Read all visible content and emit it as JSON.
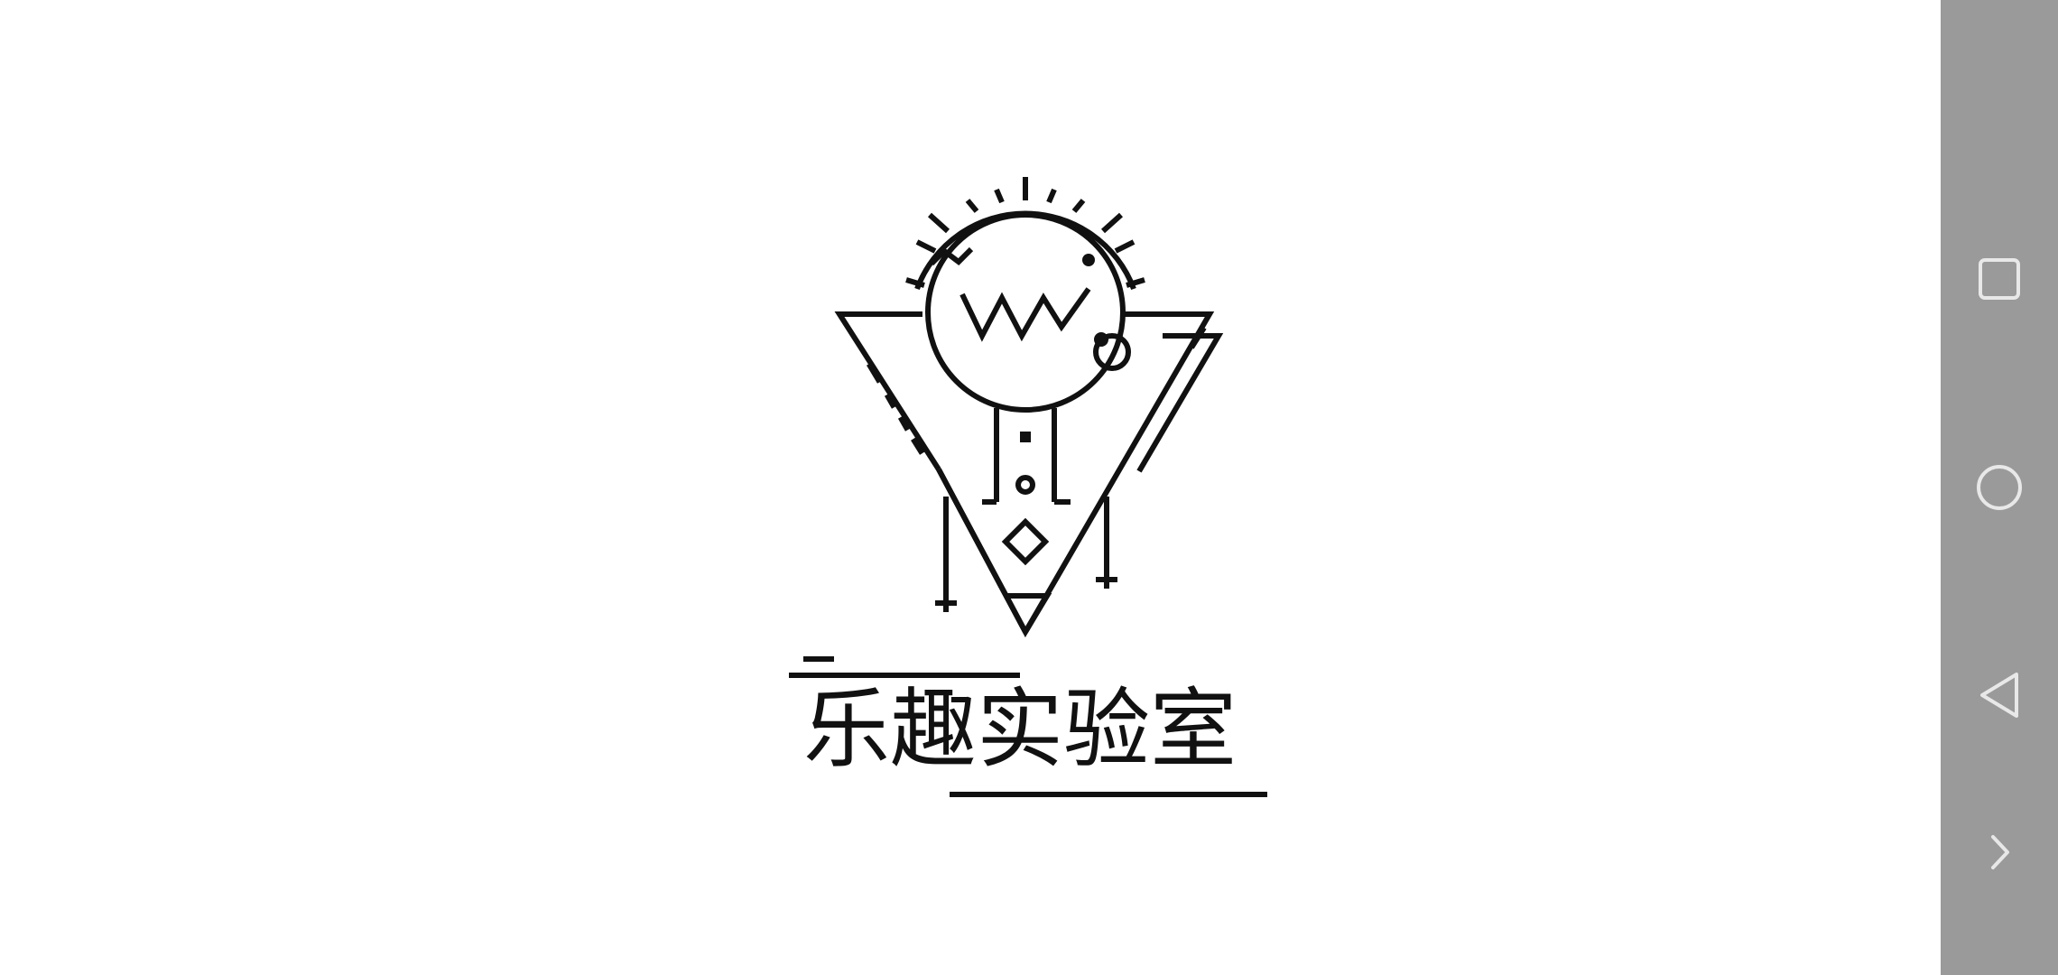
{
  "splash": {
    "brand_title": "乐趣实验室",
    "logo_icon": "science-lab-character-logo"
  },
  "nav_bar": {
    "buttons": [
      {
        "name": "recents-button",
        "icon": "square-icon"
      },
      {
        "name": "home-button",
        "icon": "circle-icon"
      },
      {
        "name": "back-button",
        "icon": "triangle-left-icon"
      },
      {
        "name": "expand-button",
        "icon": "chevron-right-icon"
      }
    ]
  },
  "colors": {
    "background": "#ffffff",
    "ink": "#111111",
    "nav_bar": "#9a9a9a",
    "nav_icon": "#e8e8e8"
  }
}
